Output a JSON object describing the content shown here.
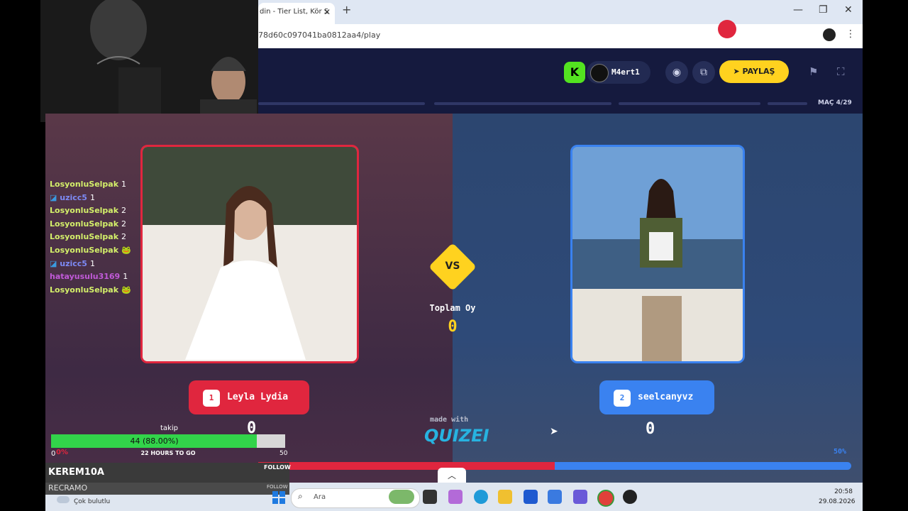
{
  "browser": {
    "tab_title": "din - Tier List, Kör S",
    "tab_close": "✕",
    "new_tab": "+",
    "url": "78d60c097041ba0812aa4/play",
    "window_buttons": [
      "—",
      "❐",
      "✕"
    ]
  },
  "header": {
    "kick_badge": "K",
    "username": "M4ert1",
    "share_label": "PAYLAŞ",
    "match_counter": "MAÇ 4/29"
  },
  "match": {
    "vs_label": "VS",
    "total_label": "Toplam Oy",
    "total_value": "0",
    "left": {
      "number": "1",
      "name": "Leyla Lydia",
      "votes": "0",
      "color": "#e0263e"
    },
    "right": {
      "number": "2",
      "name": "seelcanyvz",
      "votes": "0",
      "color": "#3a82f0",
      "percent": "50%"
    },
    "left_share": 0.5,
    "made_with": "made with",
    "brand": "QUIZEI"
  },
  "chat": [
    {
      "user": "LosyonluSelpak",
      "msg": "1",
      "color": "#d4f06a"
    },
    {
      "user": "uzicc5",
      "msg": "1",
      "color": "#7d8af5",
      "badge": true
    },
    {
      "user": "LosyonluSelpak",
      "msg": "2",
      "color": "#d4f06a"
    },
    {
      "user": "LosyonluSelpak",
      "msg": "2",
      "color": "#d4f06a"
    },
    {
      "user": "LosyonluSelpak",
      "msg": "2",
      "color": "#d4f06a"
    },
    {
      "user": "LosyonluSelpak",
      "msg": "🐸",
      "color": "#d4f06a"
    },
    {
      "user": "uzicc5",
      "msg": "1",
      "color": "#7d8af5",
      "badge": true
    },
    {
      "user": "hatayusulu3169",
      "msg": "1",
      "color": "#c05ad8"
    },
    {
      "user": "LosyonluSelpak",
      "msg": "🐸",
      "color": "#d4f06a"
    }
  ],
  "follow_goal": {
    "label": "takip",
    "progress_text": "44 (88.00%)",
    "progress": 0.88,
    "min": "0",
    "pct": "0%",
    "time_left": "22 HOURS TO GO",
    "max": "50"
  },
  "alerts": [
    {
      "name": "KEREM10A",
      "action": "FOLLOW"
    },
    {
      "name": "RECRAMO",
      "action": "FOLLOW"
    }
  ],
  "taskbar": {
    "weather": "Çok bulutlu",
    "search_placeholder": "Ara",
    "time": "20:58",
    "date": "29.08.2026"
  }
}
